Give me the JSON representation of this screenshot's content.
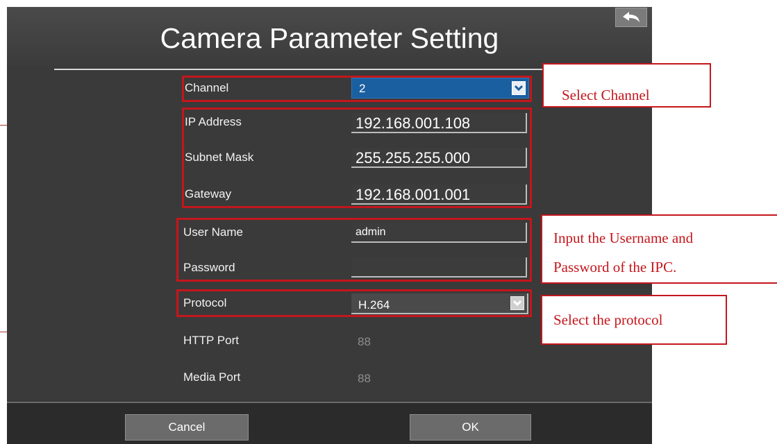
{
  "window": {
    "title": "Camera Parameter Setting"
  },
  "icons": {
    "back": "back-arrow-icon",
    "dropdown": "chevron-down-icon"
  },
  "form": {
    "channel": {
      "label": "Channel",
      "value": "2"
    },
    "ip_address": {
      "label": "IP Address",
      "value": "192.168.001.108"
    },
    "subnet_mask": {
      "label": "Subnet Mask",
      "value": "255.255.255.000"
    },
    "gateway": {
      "label": "Gateway",
      "value": "192.168.001.001"
    },
    "user_name": {
      "label": "User Name",
      "value": "admin"
    },
    "password": {
      "label": "Password",
      "value": ""
    },
    "protocol": {
      "label": "Protocol",
      "value": "H.264"
    },
    "http_port": {
      "label": "HTTP Port",
      "value": "88"
    },
    "media_port": {
      "label": "Media Port",
      "value": "88"
    }
  },
  "buttons": {
    "cancel": "Cancel",
    "ok": "OK"
  },
  "callouts": {
    "channel": "Select Channel",
    "credentials_line1": "Input the Username and",
    "credentials_line2": "Password of the IPC.",
    "protocol": "Select the protocol"
  },
  "colors": {
    "annotation_red": "#c4161c",
    "dialog_bg": "#3a3a3a",
    "select_blue": "#1a5fa0"
  }
}
